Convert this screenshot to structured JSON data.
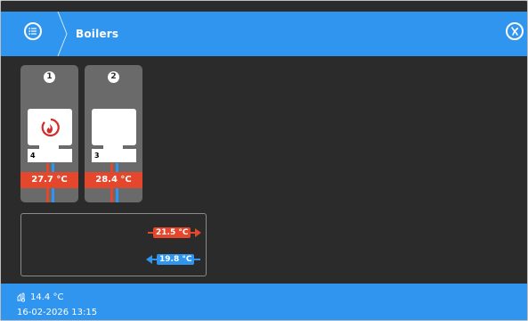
{
  "header": {
    "title": "Boilers",
    "menu_icon": "list-menu-icon",
    "right_icon": "handle-tools-icon"
  },
  "boilers": [
    {
      "index": "1",
      "unit_number": "4",
      "temperature": "27.7 °C",
      "flame": true
    },
    {
      "index": "2",
      "unit_number": "3",
      "temperature": "28.4 °C",
      "flame": false
    }
  ],
  "circuit": {
    "supply": "21.5 °C",
    "return": "19.8 °C"
  },
  "footer": {
    "outdoor_temperature": "14.4 °C",
    "datetime": "16-02-2026 13:15"
  },
  "colors": {
    "header": "#2f95ef",
    "background": "#2b2b2b",
    "boiler_card": "#6a6a6a",
    "hot": "#e4472b",
    "cold": "#2f95ef"
  }
}
